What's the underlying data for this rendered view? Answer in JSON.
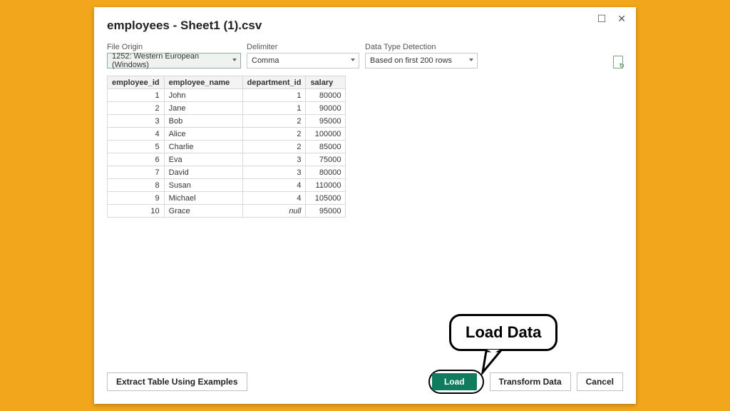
{
  "title": "employees - Sheet1 (1).csv",
  "options": {
    "file_origin": {
      "label": "File Origin",
      "value": "1252: Western European (Windows)"
    },
    "delimiter": {
      "label": "Delimiter",
      "value": "Comma"
    },
    "detection": {
      "label": "Data Type Detection",
      "value": "Based on first 200 rows"
    }
  },
  "columns": [
    "employee_id",
    "employee_name",
    "department_id",
    "salary"
  ],
  "rows": [
    {
      "id": "1",
      "name": "John",
      "dept": "1",
      "salary": "80000"
    },
    {
      "id": "2",
      "name": "Jane",
      "dept": "1",
      "salary": "90000"
    },
    {
      "id": "3",
      "name": "Bob",
      "dept": "2",
      "salary": "95000"
    },
    {
      "id": "4",
      "name": "Alice",
      "dept": "2",
      "salary": "100000"
    },
    {
      "id": "5",
      "name": "Charlie",
      "dept": "2",
      "salary": "85000"
    },
    {
      "id": "6",
      "name": "Eva",
      "dept": "3",
      "salary": "75000"
    },
    {
      "id": "7",
      "name": "David",
      "dept": "3",
      "salary": "80000"
    },
    {
      "id": "8",
      "name": "Susan",
      "dept": "4",
      "salary": "110000"
    },
    {
      "id": "9",
      "name": "Michael",
      "dept": "4",
      "salary": "105000"
    },
    {
      "id": "10",
      "name": "Grace",
      "dept": "null",
      "salary": "95000"
    }
  ],
  "buttons": {
    "extract": "Extract Table Using Examples",
    "load": "Load",
    "transform": "Transform Data",
    "cancel": "Cancel"
  },
  "annotation": "Load Data"
}
